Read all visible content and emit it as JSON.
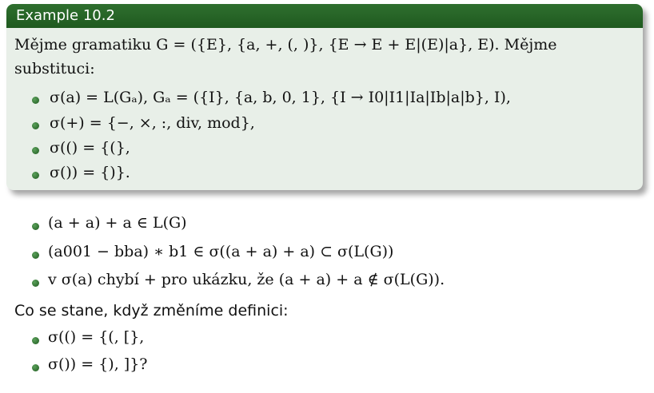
{
  "block": {
    "title": "Example 10.2",
    "intro_line1": "Mějme gramatiku G = ({E}, {a, +, (, )}, {E → E + E|(E)|a}, E). Mějme",
    "intro_line2": "substituci:",
    "items": [
      "σ(a) = L(Gₐ), Gₐ = ({I}, {a, b, 0, 1}, {I → I0|I1|Ia|Ib|a|b}, I),",
      "σ(+) = {−, ×, :, div, mod},",
      "σ(() = {(},",
      "σ()) = {)}."
    ]
  },
  "list1": [
    "(a + a) + a ∈ L(G)",
    "(a001 − bba) ∗ b1 ∈ σ((a + a) + a) ⊂ σ(L(G))",
    "v σ(a) chybí + pro ukázku, že (a + a) + a ∉ σ(L(G))."
  ],
  "question": "Co se stane, když změníme definici:",
  "list2": [
    "σ(() = {(, [},",
    "σ()) = {), ]}?"
  ],
  "colors": {
    "title_bg": "#1f5a1f",
    "block_bg": "#e8efe8",
    "bullet": "#2f6f2f"
  }
}
